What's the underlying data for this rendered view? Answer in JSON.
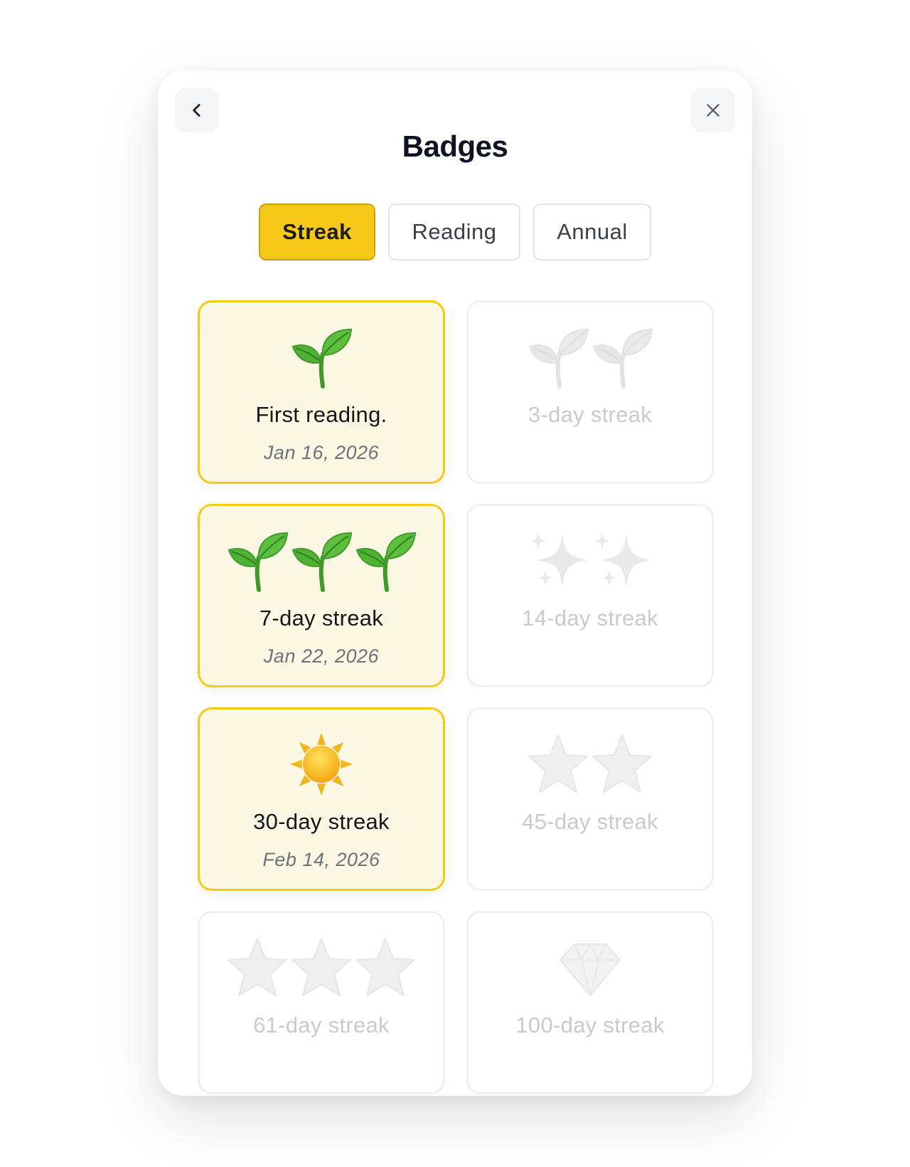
{
  "modal": {
    "title": "Badges",
    "back_icon": "chevron-left-icon",
    "close_icon": "close-icon"
  },
  "tabs": [
    {
      "label": "Streak",
      "active": true
    },
    {
      "label": "Reading",
      "active": false
    },
    {
      "label": "Annual",
      "active": false
    }
  ],
  "badges": [
    {
      "name": "First reading.",
      "date": "Jan 16, 2026",
      "earned": true,
      "icon": "sprout-icon",
      "icon_count": 1
    },
    {
      "name": "3-day streak",
      "date": "",
      "earned": false,
      "icon": "sprout-icon",
      "icon_count": 2
    },
    {
      "name": "7-day streak",
      "date": "Jan 22, 2026",
      "earned": true,
      "icon": "sprout-icon",
      "icon_count": 3
    },
    {
      "name": "14-day streak",
      "date": "",
      "earned": false,
      "icon": "sparkles-icon",
      "icon_count": 2
    },
    {
      "name": "30-day streak",
      "date": "Feb 14, 2026",
      "earned": true,
      "icon": "sun-icon",
      "icon_count": 1
    },
    {
      "name": "45-day streak",
      "date": "",
      "earned": false,
      "icon": "star-icon",
      "icon_count": 2
    },
    {
      "name": "61-day streak",
      "date": "",
      "earned": false,
      "icon": "star-icon",
      "icon_count": 3
    },
    {
      "name": "100-day streak",
      "date": "",
      "earned": false,
      "icon": "gem-icon",
      "icon_count": 1
    }
  ],
  "colors": {
    "accent": "#f6c918",
    "earned_bg": "#fcf8e4",
    "locked_text": "#c8cace"
  }
}
